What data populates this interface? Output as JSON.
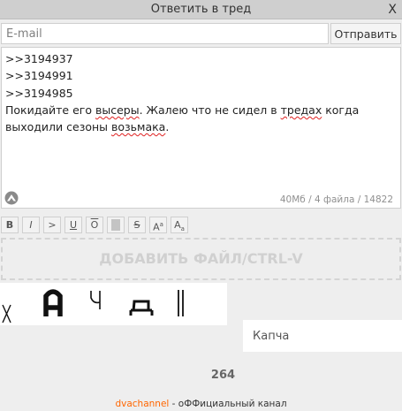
{
  "window": {
    "title": "Ответить в тред",
    "close_label": "X"
  },
  "email": {
    "placeholder": "E-mail",
    "value": ""
  },
  "send_button": {
    "label": "Отправить"
  },
  "message": {
    "lines": [
      ">>3194937",
      ">>3194991",
      ">>3194985"
    ],
    "body_segments": [
      {
        "text": "Покидайте его ",
        "misspelled": false
      },
      {
        "text": "высеры",
        "misspelled": true
      },
      {
        "text": ". Жалею что не сидел в ",
        "misspelled": false
      },
      {
        "text": "тредах",
        "misspelled": true
      },
      {
        "text": " когда выходили сезоны ",
        "misspelled": false
      },
      {
        "text": "возьмака",
        "misspelled": true
      },
      {
        "text": ".",
        "misspelled": false
      }
    ],
    "meter": "40Мб / 4 файла / 14822"
  },
  "toolbar": {
    "buttons": [
      {
        "name": "bold-button",
        "label": "B"
      },
      {
        "name": "italic-button",
        "label": "I"
      },
      {
        "name": "quote-button",
        "label": ">"
      },
      {
        "name": "underline-button",
        "label": "U"
      },
      {
        "name": "overline-button",
        "label": "O"
      },
      {
        "name": "spoiler-button",
        "label": ""
      },
      {
        "name": "strike-button",
        "label": "S"
      },
      {
        "name": "superscript-button",
        "label": "A",
        "sub": "a"
      },
      {
        "name": "subscript-button",
        "label": "A",
        "sub": "a"
      }
    ]
  },
  "dropzone": {
    "label": "ДОБАВИТЬ ФАЙЛ/CTRL-V"
  },
  "captcha": {
    "placeholder": "Капча",
    "image_glyphs": [
      "Х",
      "А",
      "Ч",
      "Д",
      "I"
    ]
  },
  "counter": "264",
  "footer": {
    "link": "dvachannel",
    "text": " - оФФициальный канал"
  },
  "colors": {
    "background": "#eeeeee",
    "titlebar": "#cfcfcf",
    "footer_link": "#ff6600",
    "spell_error": "#e02020"
  }
}
